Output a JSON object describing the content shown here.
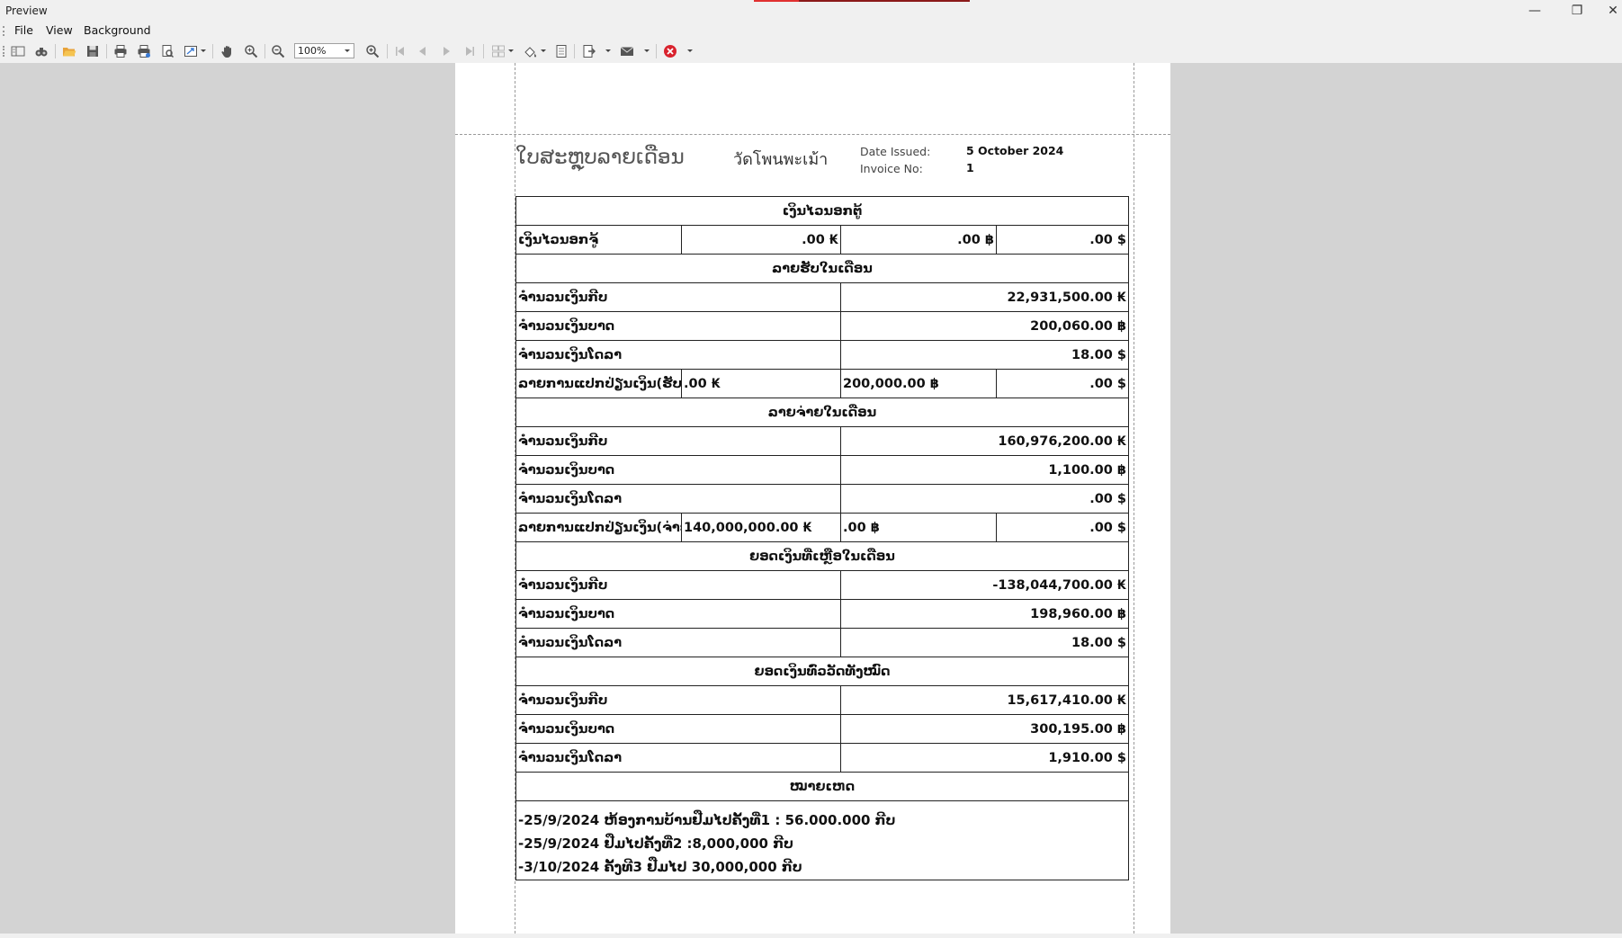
{
  "window": {
    "title": "Preview",
    "minimize": "—",
    "restore": "❐",
    "close": "✕"
  },
  "menu": {
    "items": [
      "File",
      "View",
      "Background"
    ]
  },
  "toolbar": {
    "zoom_value": "100%",
    "icons": [
      "panel-toggle-icon",
      "find-icon",
      "open-icon",
      "save-icon",
      "print-icon",
      "quick-print-icon",
      "page-setup-icon",
      "scale-icon",
      "hand-tool-icon",
      "magnifier-icon",
      "zoom-out-icon",
      "zoom-in-icon",
      "first-page-icon",
      "previous-page-icon",
      "next-page-icon",
      "last-page-icon",
      "multiple-pages-icon",
      "color-icon",
      "watermark-icon",
      "export-icon",
      "email-icon",
      "close-preview-icon"
    ]
  },
  "report": {
    "title": "ໃບສະຫຼຸບລາຍເດືອນ",
    "temple": "วัดโพนพะเม้า",
    "date_label": "Date Issued:",
    "date_value": "5 October 2024",
    "invoice_label": "Invoice No:",
    "invoice_value": "1",
    "loan": {
      "header": "ເງິນໄວນອກຕູ້",
      "row_label": "ເງິນໄວນອກຈູ້",
      "kip": ".00 ₭",
      "baht": ".00 ฿",
      "usd": ".00 $"
    },
    "income": {
      "header": "ລາຍຮັບໃນເດືອນ",
      "kip_label": "ຈຳນວນເງິນກີບ",
      "kip_value": "22,931,500.00 ₭",
      "baht_label": "ຈຳນວນເງິນບາດ",
      "baht_value": "200,060.00 ฿",
      "usd_label": "ຈຳນວນເງິນໂດລາ",
      "usd_value": "18.00 $",
      "exchange_label": "ລາຍການແປກປ່ຽນເງິນ(ຮັບ)",
      "exchange_kip": ".00 ₭",
      "exchange_baht": "200,000.00 ฿",
      "exchange_usd": ".00 $"
    },
    "expense": {
      "header": "ລາຍຈ່າຍໃນເດືອນ",
      "kip_label": "ຈຳນວນເງິນກີບ",
      "kip_value": "160,976,200.00 ₭",
      "baht_label": "ຈຳນວນເງິນບາດ",
      "baht_value": "1,100.00 ฿",
      "usd_label": "ຈຳນວນເງິນໂດລາ",
      "usd_value": ".00 $",
      "exchange_label": "ລາຍການແປກປ່ຽນເງິນ(ຈ່າຍ)",
      "exchange_kip": "140,000,000.00 ₭",
      "exchange_baht": ".00 ฿",
      "exchange_usd": ".00 $"
    },
    "balance_month": {
      "header": "ຍອດເງິນທີ່ເຫຼືອໃນເດືອນ",
      "kip_label": "ຈຳນວນເງິນກີບ",
      "kip_value": "-138,044,700.00 ₭",
      "baht_label": "ຈຳນວນເງິນບາດ",
      "baht_value": "198,960.00 ฿",
      "usd_label": "ຈຳນວນເງິນໂດລາ",
      "usd_value": "18.00 $"
    },
    "balance_total": {
      "header": "ຍອດເງິນທົ່ວວັດທັງໝົດ",
      "kip_label": "ຈຳນວນເງິນກີບ",
      "kip_value": "15,617,410.00 ₭",
      "baht_label": "ຈຳນວນເງິນບາດ",
      "baht_value": "300,195.00 ฿",
      "usd_label": "ຈຳນວນເງິນໂດລາ",
      "usd_value": "1,910.00 $"
    },
    "notes": {
      "header": "ໝາຍເຫດ",
      "lines": [
        "-25/9/2024 ຫ້ອງການບ້ານຢືມໄປຄັ້ງທີ່1 : 56.000.000 ກີບ",
        "-25/9/2024 ຢືມໄປຄັ້ງທີ່2 :8,000,000 ກີບ",
        "-3/10/2024 ຄັ້ງທີ3 ຢືມໄປ 30,000,000 ກີບ"
      ]
    }
  }
}
